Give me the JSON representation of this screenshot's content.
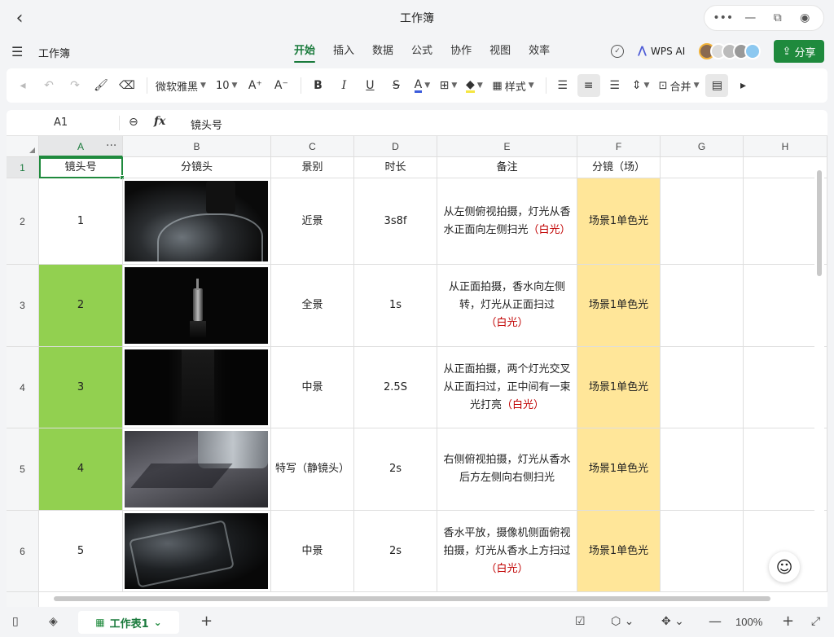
{
  "window": {
    "title": "工作簿"
  },
  "menu": {
    "doc_name": "工作簿",
    "tabs": [
      {
        "label": "开始",
        "active": true
      },
      {
        "label": "插入"
      },
      {
        "label": "数据"
      },
      {
        "label": "公式"
      },
      {
        "label": "协作"
      },
      {
        "label": "视图"
      },
      {
        "label": "效率"
      }
    ],
    "ai_label": "WPS AI",
    "share_label": "分享"
  },
  "toolbar": {
    "font_name": "微软雅黑",
    "font_size": "10",
    "style_label": "样式",
    "merge_label": "合并"
  },
  "formula_bar": {
    "cell_ref": "A1",
    "fx_label": "fx",
    "value": "镜头号"
  },
  "sheet": {
    "columns": [
      "A",
      "B",
      "C",
      "D",
      "E",
      "F",
      "G",
      "H"
    ],
    "rows": [
      "1",
      "2",
      "3",
      "4",
      "5",
      "6"
    ],
    "header": [
      "镜头号",
      "分镜头",
      "景别",
      "时长",
      "备注",
      "分镜（场）"
    ],
    "data": [
      {
        "shot": "1",
        "scene": "近景",
        "dur": "3s8f",
        "note": "从左侧俯视拍摄，灯光从香水正面向左侧扫光",
        "note_tag": "（白光）",
        "frame": "场景1单色光"
      },
      {
        "shot": "2",
        "scene": "全景",
        "dur": "1s",
        "note": "从正面拍摄，香水向左侧转，灯光从正面扫过",
        "note_tag": "（白光）",
        "frame": "场景1单色光"
      },
      {
        "shot": "3",
        "scene": "中景",
        "dur": "2.5S",
        "note": "从正面拍摄，两个灯光交叉从正面扫过，正中间有一束光打亮",
        "note_tag": "（白光）",
        "frame": "场景1单色光"
      },
      {
        "shot": "4",
        "scene": "特写（静镜头）",
        "dur": "2s",
        "note": "右侧俯视拍摄，灯光从香水后方左侧向右侧扫光",
        "note_tag": "",
        "frame": "场景1单色光"
      },
      {
        "shot": "5",
        "scene": "中景",
        "dur": "2s",
        "note": "香水平放，摄像机侧面俯视拍摄，灯光从香水上方扫过",
        "note_tag": "（白光）",
        "frame": "场景1单色光"
      }
    ]
  },
  "bottom": {
    "sheet_tab": "工作表1",
    "zoom": "100%"
  },
  "colors": {
    "accent": "#1f8a3d",
    "green_fill": "#92d050",
    "yellow_fill": "#ffe699",
    "note_red": "#c00000"
  }
}
